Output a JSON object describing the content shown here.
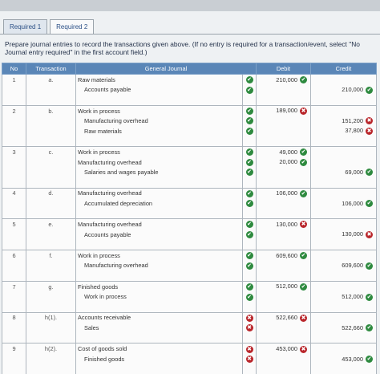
{
  "tabs": [
    "Required 1",
    "Required 2"
  ],
  "instructions": "Prepare journal entries to record the transactions given above. (If no entry is required for a transaction/event, select \"No Journal entry required\" in the first account field.)",
  "columns": {
    "no": "No",
    "transaction": "Transaction",
    "general_journal": "General Journal",
    "debit": "Debit",
    "credit": "Credit"
  },
  "entries": [
    {
      "no": "1",
      "transaction": "a.",
      "lines": [
        {
          "account": "Raw materials",
          "side": "debit",
          "amount": "210,000",
          "acct_status": "ok",
          "amt_status": "ok"
        },
        {
          "account": "Accounts payable",
          "side": "credit",
          "amount": "210,000",
          "acct_status": "ok",
          "amt_status": "ok"
        }
      ]
    },
    {
      "no": "2",
      "transaction": "b.",
      "lines": [
        {
          "account": "Work in process",
          "side": "debit",
          "amount": "189,000",
          "acct_status": "ok",
          "amt_status": "bad"
        },
        {
          "account": "Manufacturing overhead",
          "side": "credit",
          "amount": "151,200",
          "acct_status": "ok",
          "amt_status": "bad"
        },
        {
          "account": "Raw materials",
          "side": "credit",
          "amount": "37,800",
          "acct_status": "ok",
          "amt_status": "bad"
        }
      ]
    },
    {
      "no": "3",
      "transaction": "c.",
      "lines": [
        {
          "account": "Work in process",
          "side": "debit",
          "amount": "49,000",
          "acct_status": "ok",
          "amt_status": "ok"
        },
        {
          "account": "Manufacturing overhead",
          "side": "debit",
          "amount": "20,000",
          "acct_status": "ok",
          "amt_status": "ok"
        },
        {
          "account": "Salaries and wages payable",
          "side": "credit",
          "amount": "69,000",
          "acct_status": "ok",
          "amt_status": "ok"
        }
      ]
    },
    {
      "no": "4",
      "transaction": "d.",
      "lines": [
        {
          "account": "Manufacturing overhead",
          "side": "debit",
          "amount": "106,000",
          "acct_status": "ok",
          "amt_status": "ok"
        },
        {
          "account": "Accumulated depreciation",
          "side": "credit",
          "amount": "106,000",
          "acct_status": "ok",
          "amt_status": "ok"
        }
      ]
    },
    {
      "no": "5",
      "transaction": "e.",
      "lines": [
        {
          "account": "Manufacturing overhead",
          "side": "debit",
          "amount": "130,000",
          "acct_status": "ok",
          "amt_status": "bad"
        },
        {
          "account": "Accounts payable",
          "side": "credit",
          "amount": "130,000",
          "acct_status": "ok",
          "amt_status": "bad"
        }
      ]
    },
    {
      "no": "6",
      "transaction": "f.",
      "lines": [
        {
          "account": "Work in process",
          "side": "debit",
          "amount": "609,600",
          "acct_status": "ok",
          "amt_status": "ok"
        },
        {
          "account": "Manufacturing overhead",
          "side": "credit",
          "amount": "609,600",
          "acct_status": "ok",
          "amt_status": "ok"
        }
      ]
    },
    {
      "no": "7",
      "transaction": "g.",
      "lines": [
        {
          "account": "Finished goods",
          "side": "debit",
          "amount": "512,000",
          "acct_status": "ok",
          "amt_status": "ok"
        },
        {
          "account": "Work in process",
          "side": "credit",
          "amount": "512,000",
          "acct_status": "ok",
          "amt_status": "ok"
        }
      ]
    },
    {
      "no": "8",
      "transaction": "h(1).",
      "lines": [
        {
          "account": "Accounts receivable",
          "side": "debit",
          "amount": "522,660",
          "acct_status": "bad",
          "amt_status": "bad"
        },
        {
          "account": "Sales",
          "side": "credit",
          "amount": "522,660",
          "acct_status": "bad",
          "amt_status": "ok"
        }
      ]
    },
    {
      "no": "9",
      "transaction": "h(2).",
      "lines": [
        {
          "account": "Cost of goods sold",
          "side": "debit",
          "amount": "453,000",
          "acct_status": "bad",
          "amt_status": "bad"
        },
        {
          "account": "Finished goods",
          "side": "credit",
          "amount": "453,000",
          "acct_status": "bad",
          "amt_status": "ok"
        }
      ]
    }
  ],
  "status_glyphs": {
    "ok": "✔",
    "bad": "✖"
  },
  "colors": {
    "header": "#5a86b7",
    "ok": "#2e8a3f",
    "bad": "#b9262b",
    "tab_text": "#2a4f86"
  }
}
